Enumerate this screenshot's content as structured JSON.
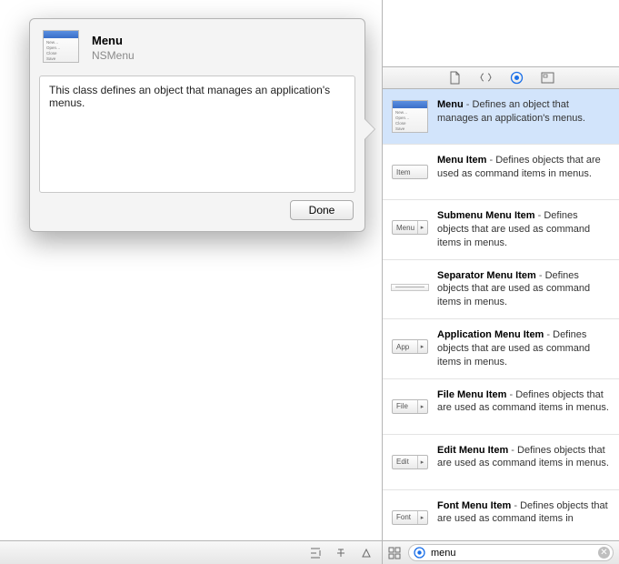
{
  "popover": {
    "title": "Menu",
    "subtitle": "NSMenu",
    "description": "This class defines an object that manages an application's menus.",
    "done_label": "Done",
    "thumb_lines": "New…\nOpen…\nClose\nSave"
  },
  "tabbar": {
    "tabs": [
      "file-template",
      "code-snippet",
      "object-library",
      "media-library"
    ],
    "active_index": 2
  },
  "library": [
    {
      "title": "Menu",
      "desc": "Defines an object that manages an application's menus.",
      "thumb": "menu"
    },
    {
      "title": "Menu Item",
      "desc": "Defines objects that are used as command items in menus.",
      "thumb": "item",
      "thumb_label": "Item"
    },
    {
      "title": "Submenu Menu Item",
      "desc": "Defines objects that are used as command items in menus.",
      "thumb": "pill",
      "thumb_label": "Menu"
    },
    {
      "title": "Separator Menu Item",
      "desc": "Defines objects that are used as command items in menus.",
      "thumb": "sep"
    },
    {
      "title": "Application Menu Item",
      "desc": "Defines objects that are used as command items in menus.",
      "thumb": "pill",
      "thumb_label": "App"
    },
    {
      "title": "File Menu Item",
      "desc": "Defines objects that are used as command items in menus.",
      "thumb": "pill",
      "thumb_label": "File"
    },
    {
      "title": "Edit Menu Item",
      "desc": "Defines objects that are used as command items in menus.",
      "thumb": "pill",
      "thumb_label": "Edit"
    },
    {
      "title": "Font Menu Item",
      "desc": "Defines objects that are used as command items in",
      "thumb": "pill",
      "thumb_label": "Font"
    }
  ],
  "selected_index": 0,
  "search": {
    "value": "menu"
  }
}
